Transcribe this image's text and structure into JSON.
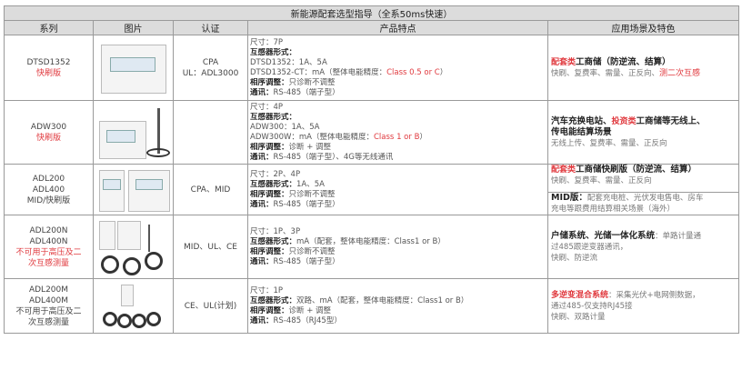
{
  "title": "新能源配套选型指导（全系50ms快速）",
  "headers": [
    "系列",
    "图片",
    "认证",
    "产品特点",
    "应用场景及特色"
  ],
  "rows": [
    {
      "series": [
        "DTSD1352"
      ],
      "series_red": [
        "快刷版"
      ],
      "series_after": [],
      "cert": [
        "CPA",
        "UL：ADL3000"
      ],
      "features": [
        [
          {
            "t": "尺寸：7P"
          }
        ],
        [
          {
            "t": "互感器形式：",
            "b": true
          }
        ],
        [
          {
            "t": "DTSD1352：1A、5A"
          }
        ],
        [
          {
            "t": "DTSD1352-CT：mA（整体电能精度：",
            "b": false
          },
          {
            "t": "Class 0.5 or C",
            "r": true
          },
          {
            "t": "）"
          }
        ],
        [
          {
            "t": "相序调整：",
            "b": true
          },
          {
            "t": "只诊断不调整"
          }
        ],
        [
          {
            "t": "通讯：",
            "b": true
          },
          {
            "t": "RS-485（端子型）"
          }
        ]
      ],
      "app": [
        [
          {
            "t": "配套类",
            "c": "red"
          },
          {
            "t": "工商储（防逆流、结算）",
            "c": "strong"
          }
        ],
        [
          {
            "t": "快刷、复费率、需量、正反向、",
            "c": "sub"
          },
          {
            "t": "测二次互感",
            "c": "redn"
          }
        ]
      ]
    },
    {
      "series": [
        "ADW300"
      ],
      "series_red": [
        "快刷版"
      ],
      "series_after": [],
      "cert": [],
      "features": [
        [
          {
            "t": "尺寸：4P"
          }
        ],
        [
          {
            "t": "互感器形式：",
            "b": true
          }
        ],
        [
          {
            "t": "ADW300：1A、5A"
          }
        ],
        [
          {
            "t": "ADW300W：mA（整体电能精度：",
            "b": false
          },
          {
            "t": "Class 1 or B",
            "r": true
          },
          {
            "t": "）"
          }
        ],
        [
          {
            "t": "相序调整：",
            "b": true
          },
          {
            "t": "诊断 + 调整"
          }
        ],
        [
          {
            "t": "通讯：",
            "b": true
          },
          {
            "t": "RS-485（端子型）、4G等无线通讯"
          }
        ]
      ],
      "app": [
        [
          {
            "t": "汽车充换电站、",
            "c": "strong"
          },
          {
            "t": "投资类",
            "c": "red"
          },
          {
            "t": "工商储等无线上、",
            "c": "strong"
          }
        ],
        [
          {
            "t": "传电能结算场景",
            "c": "strong"
          }
        ],
        [
          {
            "t": "无线上传、复费率、需量、正反向",
            "c": "sub"
          }
        ]
      ]
    },
    {
      "series": [
        "ADL200",
        "ADL400",
        "MID/快刷版"
      ],
      "series_red": [],
      "series_after": [],
      "cert": [
        "CPA、MID"
      ],
      "features": [
        [
          {
            "t": "尺寸：2P、4P"
          }
        ],
        [
          {
            "t": "互感器形式：",
            "b": true
          },
          {
            "t": "1A、5A"
          }
        ],
        [
          {
            "t": "相序调整：",
            "b": true
          },
          {
            "t": "只诊断不调整"
          }
        ],
        [
          {
            "t": "通讯：",
            "b": true
          },
          {
            "t": "RS-485（端子型）"
          }
        ]
      ],
      "app_top": [
        [
          {
            "t": "配套类",
            "c": "red"
          },
          {
            "t": "工商储快刷版（防逆流、结算）",
            "c": "strong"
          }
        ],
        [
          {
            "t": "快刷、复费率、需量、正反向",
            "c": "sub"
          }
        ]
      ],
      "app_bottom": [
        [
          {
            "t": "MID版：",
            "c": "strong"
          },
          {
            "t": "配套充电桩、光伏发电售电、房车",
            "c": "sub"
          }
        ],
        [
          {
            "t": "充电等跟费用结算相关场景（海外）",
            "c": "sub"
          }
        ]
      ]
    },
    {
      "series": [
        "ADL200N",
        "ADL400N"
      ],
      "series_red": [
        "不可用于高压及二",
        "次互感测量"
      ],
      "series_after": [],
      "cert": [
        "MID、UL、CE"
      ],
      "features": [
        [
          {
            "t": "尺寸：1P、3P"
          }
        ],
        [
          {
            "t": "互感器形式：",
            "b": true
          },
          {
            "t": "mA（配套，整体电能精度：Class1 or B）"
          }
        ],
        [
          {
            "t": "相序调整：",
            "b": true
          },
          {
            "t": "只诊断不调整"
          }
        ],
        [
          {
            "t": "通讯：",
            "b": true
          },
          {
            "t": "RS-485（端子型）"
          }
        ]
      ],
      "app": [
        [
          {
            "t": "户储系统、光储一体化系统",
            "c": "strong"
          },
          {
            "t": "：单路计量通",
            "c": "sub"
          }
        ],
        [
          {
            "t": "过485跟逆变器通讯，",
            "c": "sub"
          }
        ],
        [
          {
            "t": "快刷、防逆流",
            "c": "sub"
          }
        ]
      ]
    },
    {
      "series": [
        "ADL200M",
        "ADL400M"
      ],
      "series_red": [],
      "series_after": [
        "不可用于高压及二",
        "次互感测量"
      ],
      "cert": [
        "CE、UL(计划)"
      ],
      "features": [
        [
          {
            "t": "尺寸：1P"
          }
        ],
        [
          {
            "t": "互感器形式：",
            "b": true
          },
          {
            "t": "双路、mA（配套，整体电能精度：Class1 or B）"
          }
        ],
        [
          {
            "t": "相序调整：",
            "b": true
          },
          {
            "t": "诊断 + 调整"
          }
        ],
        [
          {
            "t": "通讯：",
            "b": true
          },
          {
            "t": "RS-485（RJ45型）"
          }
        ]
      ],
      "app": [
        [
          {
            "t": "多逆变混合系统",
            "c": "red"
          },
          {
            "t": "：采集光伏+电网侧数据，",
            "c": "sub"
          }
        ],
        [
          {
            "t": "通过485-仅支持RJ45接",
            "c": "sub"
          }
        ],
        [
          {
            "t": "快刷、双路计量",
            "c": "sub"
          }
        ]
      ]
    }
  ]
}
